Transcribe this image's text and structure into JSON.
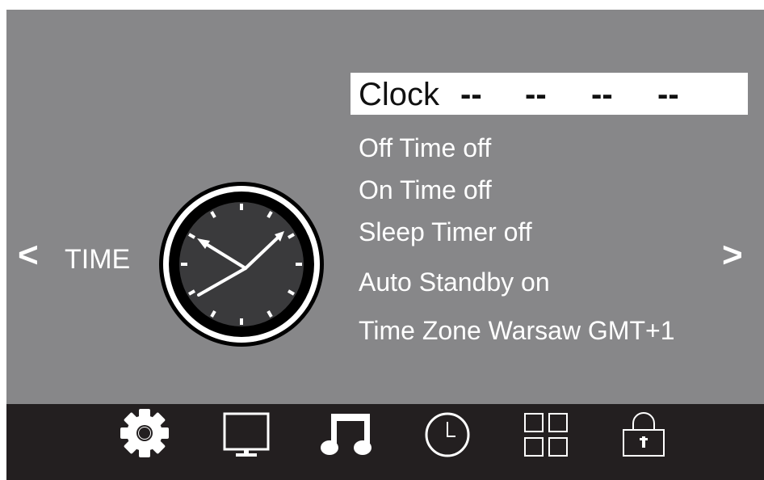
{
  "section": {
    "title": "TIME",
    "prev_arrow": "<",
    "next_arrow": ">"
  },
  "menu": {
    "clock": {
      "label": "Clock",
      "value": [
        "--",
        "--",
        "--",
        "--"
      ]
    },
    "items": [
      "Off Time off",
      "On Time off",
      "Sleep Timer off",
      "Auto Standby on",
      "Time Zone Warsaw GMT+1"
    ]
  },
  "bottom_nav": {
    "icons": [
      "gear-icon",
      "monitor-icon",
      "music-note-icon",
      "clock-icon",
      "grid-icon",
      "lock-icon"
    ],
    "active": "clock-icon"
  },
  "colors": {
    "panel_bg": "#878789",
    "bottom_bar_bg": "#231f20",
    "highlight_bg": "#ffffff",
    "text": "#ffffff"
  }
}
